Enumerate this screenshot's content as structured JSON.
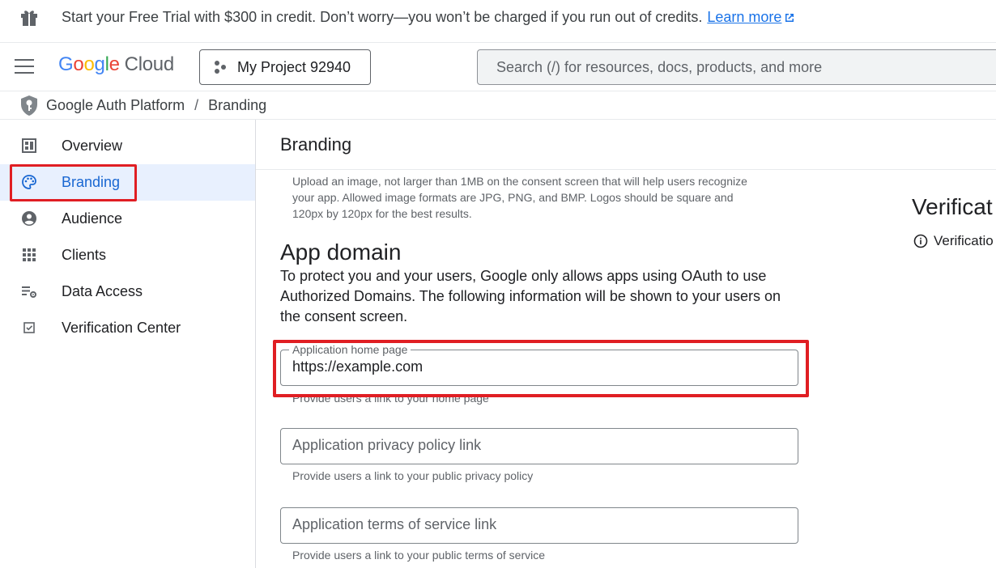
{
  "banner": {
    "text": "Start your Free Trial with $300 in credit. Don’t worry—you won’t be charged if you run out of credits.",
    "link": "Learn more"
  },
  "header": {
    "logo_google": [
      "G",
      "o",
      "o",
      "g",
      "l",
      "e"
    ],
    "logo_cloud": "Cloud",
    "project": "My Project 92940",
    "search_placeholder": "Search (/) for resources, docs, products, and more"
  },
  "breadcrumb": {
    "parent": "Google Auth Platform",
    "separator": "/",
    "current": "Branding"
  },
  "sidebar": {
    "items": [
      {
        "label": "Overview",
        "icon": "dashboard-icon"
      },
      {
        "label": "Branding",
        "icon": "palette-icon",
        "active": true
      },
      {
        "label": "Audience",
        "icon": "account-circle-icon"
      },
      {
        "label": "Clients",
        "icon": "apps-grid-icon"
      },
      {
        "label": "Data Access",
        "icon": "data-settings-icon"
      },
      {
        "label": "Verification Center",
        "icon": "checkbox-icon"
      }
    ]
  },
  "main": {
    "title": "Branding",
    "logo_help": "Upload an image, not larger than 1MB on the consent screen that will help users recognize your app. Allowed image formats are JPG, PNG, and BMP. Logos should be square and 120px by 120px for the best results.",
    "section_title": "App domain",
    "section_desc": "To protect you and your users, Google only allows apps using OAuth to use Authorized Domains. The following information will be shown to your users on the consent screen.",
    "fields": [
      {
        "label": "Application home page",
        "value": "https://example.com",
        "hint": "Provide users a link to your home page"
      },
      {
        "label": "Application privacy policy link",
        "value": "",
        "hint": "Provide users a link to your public privacy policy"
      },
      {
        "label": "Application terms of service link",
        "value": "",
        "hint": "Provide users a link to your public terms of service"
      }
    ]
  },
  "right_panel": {
    "title": "Verificat",
    "info": "Verificatio"
  },
  "colors": {
    "accent": "#1a73e8",
    "active_bg": "#e8f0fe",
    "highlight": "#e01e23"
  }
}
